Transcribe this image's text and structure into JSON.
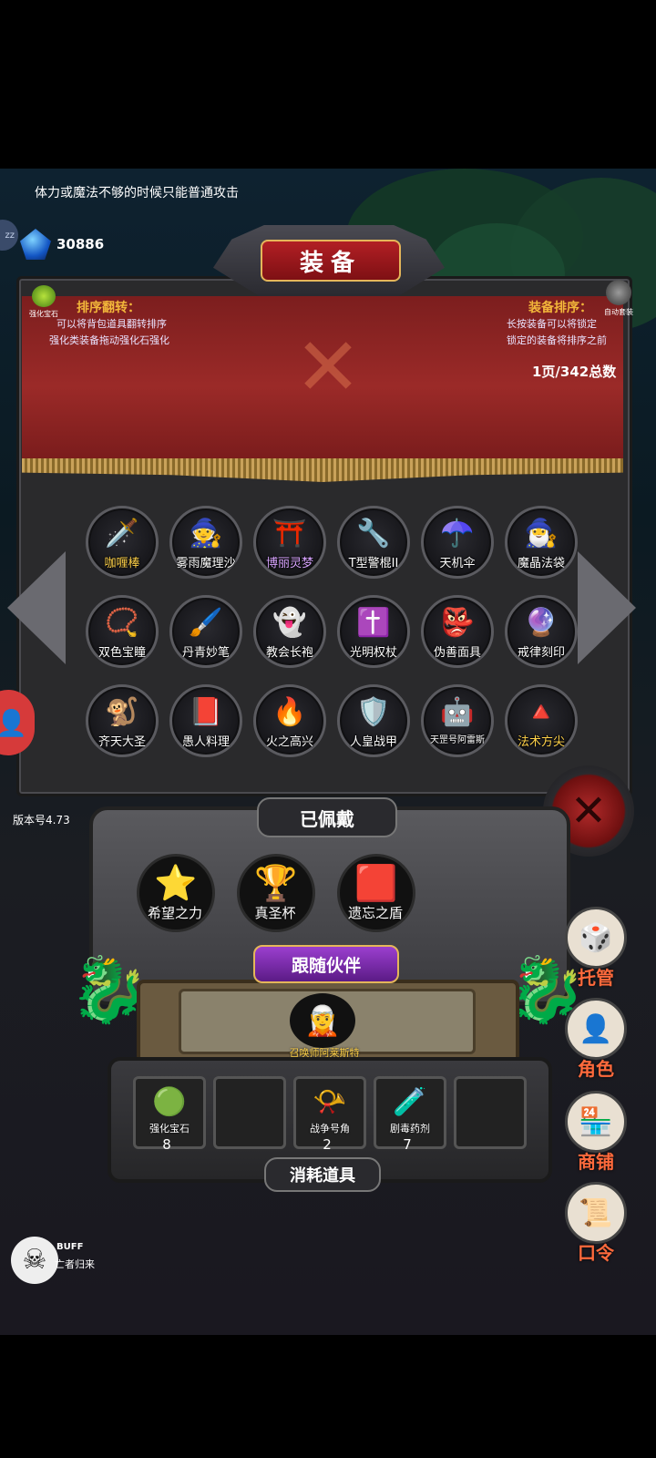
{
  "hint": "体力或魔法不够的时候只能普通攻击",
  "gems": {
    "score": "30886",
    "icon": "blue-gem-icon"
  },
  "side_badge": "zz",
  "panel": {
    "title": "装备",
    "enhance_gem_label": "强化宝石",
    "auto_suit_label": "自动套装",
    "sort_flip": {
      "title": "排序翻转：",
      "line1": "可以将背包道具翻转排序",
      "line2": "强化类装备拖动强化石强化"
    },
    "equip_sort": {
      "title": "装备排序：",
      "line1": "长按装备可以将锁定",
      "line2": "锁定的装备将排序之前"
    },
    "page_count": "1页/342总数"
  },
  "grid": [
    {
      "label": "咖喱棒",
      "glyph": "🗡️",
      "color": "gold"
    },
    {
      "label": "雾雨魔理沙",
      "glyph": "🧙",
      "color": ""
    },
    {
      "label": "博丽灵梦",
      "glyph": "⛩️",
      "color": "purple"
    },
    {
      "label": "T型警棍II",
      "glyph": "🔧",
      "color": ""
    },
    {
      "label": "天机伞",
      "glyph": "☂️",
      "color": ""
    },
    {
      "label": "魔晶法袋",
      "glyph": "🧙‍♂️",
      "color": ""
    },
    {
      "label": "双色宝瞳",
      "glyph": "📿",
      "color": ""
    },
    {
      "label": "丹青妙笔",
      "glyph": "🖌️",
      "color": ""
    },
    {
      "label": "教会长袍",
      "glyph": "👻",
      "color": ""
    },
    {
      "label": "光明权杖",
      "glyph": "✝️",
      "color": ""
    },
    {
      "label": "伪善面具",
      "glyph": "👺",
      "color": ""
    },
    {
      "label": "戒律刻印",
      "glyph": "🔮",
      "color": ""
    },
    {
      "label": "齐天大圣",
      "glyph": "🐒",
      "color": ""
    },
    {
      "label": "愚人料理",
      "glyph": "📕",
      "color": ""
    },
    {
      "label": "火之高兴",
      "glyph": "🔥",
      "color": ""
    },
    {
      "label": "人皇战甲",
      "glyph": "🛡️",
      "color": ""
    },
    {
      "label": "天罡号阿雷斯",
      "glyph": "🤖",
      "color": "small"
    },
    {
      "label": "法术方尖",
      "glyph": "🔺",
      "color": "gold"
    }
  ],
  "equipped": {
    "title": "已佩戴",
    "items": [
      {
        "label": "希望之力",
        "glyph": "⭐"
      },
      {
        "label": "真圣杯",
        "glyph": "🏆"
      },
      {
        "label": "遗忘之盾",
        "glyph": "🟥"
      }
    ]
  },
  "companion": {
    "title": "跟随伙伴",
    "name": "召唤师阿莱斯特",
    "glyph": "🧝"
  },
  "consumables": {
    "title": "消耗道具",
    "items": [
      {
        "label": "强化宝石",
        "glyph": "🟢",
        "count": "8"
      },
      {
        "label": "",
        "glyph": "",
        "count": ""
      },
      {
        "label": "战争号角",
        "glyph": "📯",
        "count": "2"
      },
      {
        "label": "剧毒药剂",
        "glyph": "🧪",
        "count": "7"
      },
      {
        "label": "",
        "glyph": "",
        "count": ""
      }
    ]
  },
  "side_menu": [
    {
      "label": "托管",
      "glyph": "🎲"
    },
    {
      "label": "角色",
      "glyph": "👤"
    },
    {
      "label": "商铺",
      "glyph": "🏪"
    },
    {
      "label": "口令",
      "glyph": "📜"
    }
  ],
  "version": "版本号4.73",
  "buff": {
    "title": "BUFF",
    "subtitle": "亡者归来"
  }
}
